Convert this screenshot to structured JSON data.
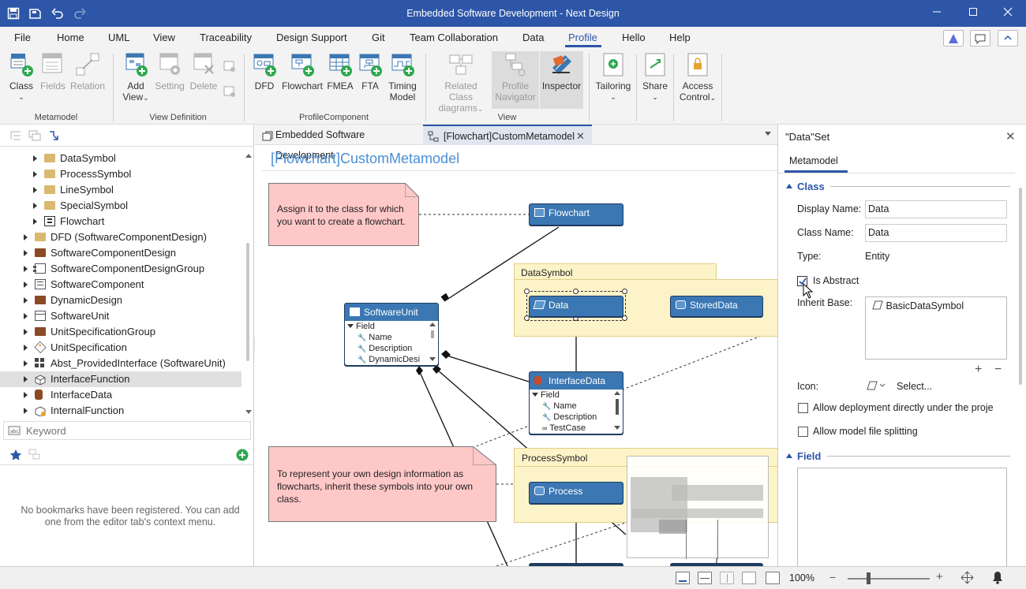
{
  "window": {
    "title": "Embedded Software Development - Next Design"
  },
  "menu": [
    "File",
    "Home",
    "UML",
    "View",
    "Traceability",
    "Design Support",
    "Git",
    "Team Collaboration",
    "Data",
    "Profile",
    "Hello",
    "Help"
  ],
  "menu_active": "Profile",
  "ribbon": {
    "metamodel": {
      "class": "Class",
      "fields": "Fields",
      "relation": "Relation",
      "group": "Metamodel"
    },
    "view_def": {
      "add_view": "Add",
      "add_view2": "View",
      "setting": "Setting",
      "delete": "Delete",
      "group": "View Definition"
    },
    "profile_component": {
      "dfd": "DFD",
      "flowchart": "Flowchart",
      "fmea": "FMEA",
      "fta": "FTA",
      "timing": "Timing",
      "timing2": "Model",
      "group": "ProfileComponent"
    },
    "view": {
      "related1": "Related Class",
      "related2": "diagrams",
      "profile_nav1": "Profile",
      "profile_nav2": "Navigator",
      "inspector": "Inspector",
      "group": "View"
    },
    "tailoring": "Tailoring",
    "share": "Share",
    "access1": "Access",
    "access2": "Control"
  },
  "tree": [
    {
      "label": "DataSymbol",
      "indent": 1,
      "icon": "folder"
    },
    {
      "label": "ProcessSymbol",
      "indent": 1,
      "icon": "folder"
    },
    {
      "label": "LineSymbol",
      "indent": 1,
      "icon": "folder"
    },
    {
      "label": "SpecialSymbol",
      "indent": 1,
      "icon": "folder"
    },
    {
      "label": "Flowchart",
      "indent": 1,
      "icon": "flowchart"
    },
    {
      "label": "DFD (SoftwareComponentDesign)",
      "indent": 0,
      "icon": "folder"
    },
    {
      "label": "SoftwareComponentDesign",
      "indent": 0,
      "icon": "folder-dark"
    },
    {
      "label": "SoftwareComponentDesignGroup",
      "indent": 0,
      "icon": "component"
    },
    {
      "label": "SoftwareComponent",
      "indent": 0,
      "icon": "doc"
    },
    {
      "label": "DynamicDesign",
      "indent": 0,
      "icon": "folder-dark"
    },
    {
      "label": "SoftwareUnit",
      "indent": 0,
      "icon": "class"
    },
    {
      "label": "UnitSpecificationGroup",
      "indent": 0,
      "icon": "folder-dark"
    },
    {
      "label": "UnitSpecification",
      "indent": 0,
      "icon": "tag"
    },
    {
      "label": "Abst_ProvidedInterface (SoftwareUnit)",
      "indent": 0,
      "icon": "grid"
    },
    {
      "label": "InterfaceFunction",
      "indent": 0,
      "icon": "cube",
      "selected": true
    },
    {
      "label": "InterfaceData",
      "indent": 0,
      "icon": "cylinder"
    },
    {
      "label": "InternalFunction",
      "indent": 0,
      "icon": "cube-gear"
    }
  ],
  "search_placeholder": "Keyword",
  "bookmarks_empty": "No bookmarks have been registered. You can add one from the editor tab's context menu.",
  "tabs": [
    {
      "label": "Embedded Software Development"
    },
    {
      "label": "[Flowchart]CustomMetamodel"
    }
  ],
  "diagram": {
    "title": "[Flowchart]CustomMetamodel",
    "note1": "Assign it to the class for which you want to create a flowchart.",
    "note2": "To represent your own design information as flowcharts, inherit these symbols into your own class.",
    "flowchart": "Flowchart",
    "datasymbol_group": "DataSymbol",
    "data": "Data",
    "storeddata": "StoredData",
    "softwareunit": "SoftwareUnit",
    "su_field": "Field",
    "su_fields": [
      "Name",
      "Description",
      "DynamicDesi"
    ],
    "interfacedata": "InterfaceData",
    "id_field": "Field",
    "id_fields": [
      "Name",
      "Description",
      "TestCase"
    ],
    "processsymbol_group": "ProcessSymbol",
    "process": "Process"
  },
  "props": {
    "title": "\"Data\"Set",
    "tab": "Metamodel",
    "section_class": "Class",
    "display_name_label": "Display Name:",
    "display_name": "Data",
    "class_name_label": "Class Name:",
    "class_name": "Data",
    "type_label": "Type:",
    "type": "Entity",
    "is_abstract": "Is Abstract",
    "inherit_label": "Inherit Base:",
    "inherit_item": "BasicDataSymbol",
    "icon_label": "Icon:",
    "icon_select": "Select...",
    "allow_deploy": "Allow deployment directly under the proje",
    "allow_split": "Allow model file splitting",
    "section_field": "Field"
  },
  "status": {
    "zoom": "100%"
  },
  "colors": {
    "titlebar": "#2d56a8",
    "node": "#3b77b3",
    "note": "#ffc8c8",
    "group": "#fdf3c8",
    "link": "#2d56a8"
  }
}
